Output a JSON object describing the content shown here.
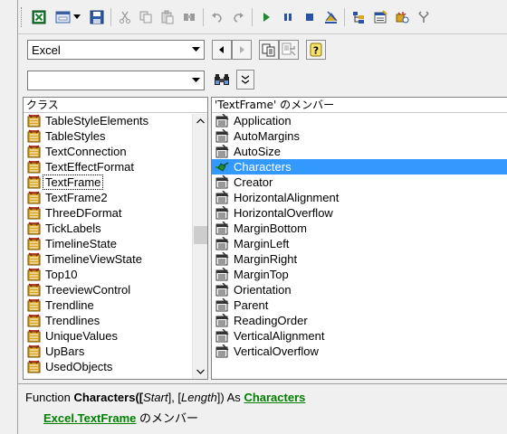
{
  "toolbar": {
    "icons": [
      "excel-icon",
      "form-icon",
      "dropdown-arrow-icon",
      "save-icon",
      "cut-icon",
      "copy-icon",
      "paste-icon",
      "find-icon",
      "undo-icon",
      "redo-icon",
      "run-icon",
      "pause-icon",
      "stop-icon",
      "design-mode-icon",
      "project-explorer-icon",
      "properties-icon",
      "object-browser-icon",
      "toolbox-icon"
    ]
  },
  "library_combo": {
    "value": "Excel"
  },
  "search_combo": {
    "value": ""
  },
  "classes_pane": {
    "header": "クラス",
    "items": [
      "TableStyleElements",
      "TableStyles",
      "TextConnection",
      "TextEffectFormat",
      "TextFrame",
      "TextFrame2",
      "ThreeDFormat",
      "TickLabels",
      "TimelineState",
      "TimelineViewState",
      "Top10",
      "TreeviewControl",
      "Trendline",
      "Trendlines",
      "UniqueValues",
      "UpBars",
      "UsedObjects"
    ],
    "focused_index": 4
  },
  "members_pane": {
    "header": "'TextFrame' のメンバー",
    "items": [
      "Application",
      "AutoMargins",
      "AutoSize",
      "Characters",
      "Creator",
      "HorizontalAlignment",
      "HorizontalOverflow",
      "MarginBottom",
      "MarginLeft",
      "MarginRight",
      "MarginTop",
      "Orientation",
      "Parent",
      "ReadingOrder",
      "VerticalAlignment",
      "VerticalOverflow"
    ],
    "selected_index": 3
  },
  "details": {
    "function_kw": "Function",
    "name": "Characters",
    "open": "([",
    "arg1": "Start",
    "mid": "], [",
    "arg2": "Length",
    "close": "]) As",
    "return_type": "Characters",
    "lib_link": "Excel",
    "dot": ".",
    "class_link": "TextFrame",
    "member_of": " のメンバー"
  },
  "colors": {
    "selection": "#3399ff",
    "link": "#008000"
  }
}
